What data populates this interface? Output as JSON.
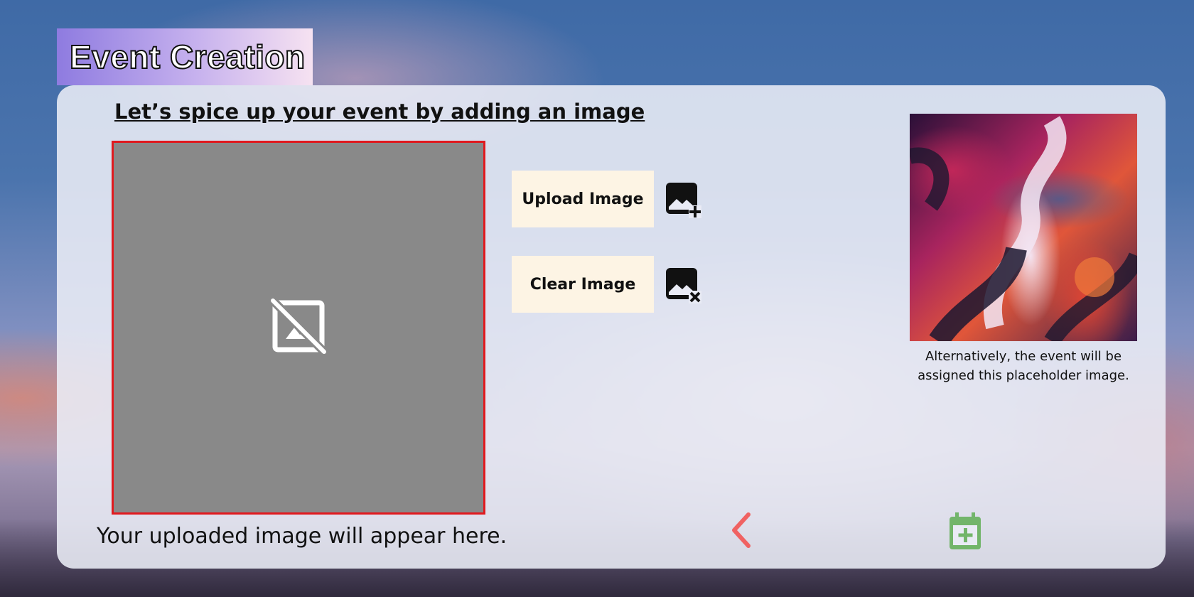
{
  "header": {
    "title": "Event Creation"
  },
  "main": {
    "heading": "Let’s spice up your event by adding an image",
    "preview_caption": "Your uploaded image will appear here.",
    "upload_button_label": "Upload Image",
    "clear_button_label": "Clear Image",
    "placeholder_caption": "Alternatively, the event will be assigned this placeholder image."
  },
  "icons": {
    "preview": "image-not-supported-icon",
    "upload": "add-photo-icon",
    "clear": "remove-photo-icon",
    "back": "chevron-left-icon",
    "create": "calendar-add-icon"
  },
  "colors": {
    "preview_border": "#e0191e",
    "preview_fill": "#898989",
    "button_bg": "#fdf4e4",
    "back_icon": "#f06262",
    "create_icon": "#72b56a"
  }
}
